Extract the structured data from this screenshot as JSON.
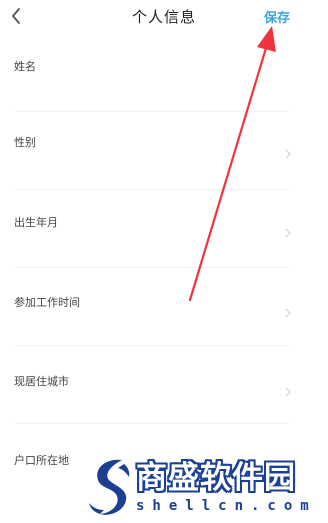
{
  "header": {
    "title": "个人信息",
    "save_label": "保存",
    "back_icon": "chevron-left-icon",
    "save_color": "#3aa3df"
  },
  "form": {
    "rows": [
      {
        "label": "姓名",
        "has_chevron": false
      },
      {
        "label": "性别",
        "has_chevron": true
      },
      {
        "label": "出生年月",
        "has_chevron": true
      },
      {
        "label": "参加工作时间",
        "has_chevron": true
      },
      {
        "label": "现居住城市",
        "has_chevron": true
      },
      {
        "label": "户口所在地",
        "has_chevron": false
      }
    ]
  },
  "annotation": {
    "color": "#f0333f",
    "icon": "red-arrow-icon"
  },
  "watermark": {
    "brand": "商盛软件园",
    "domain": "shellcn.com",
    "color": "#1a3f93"
  }
}
